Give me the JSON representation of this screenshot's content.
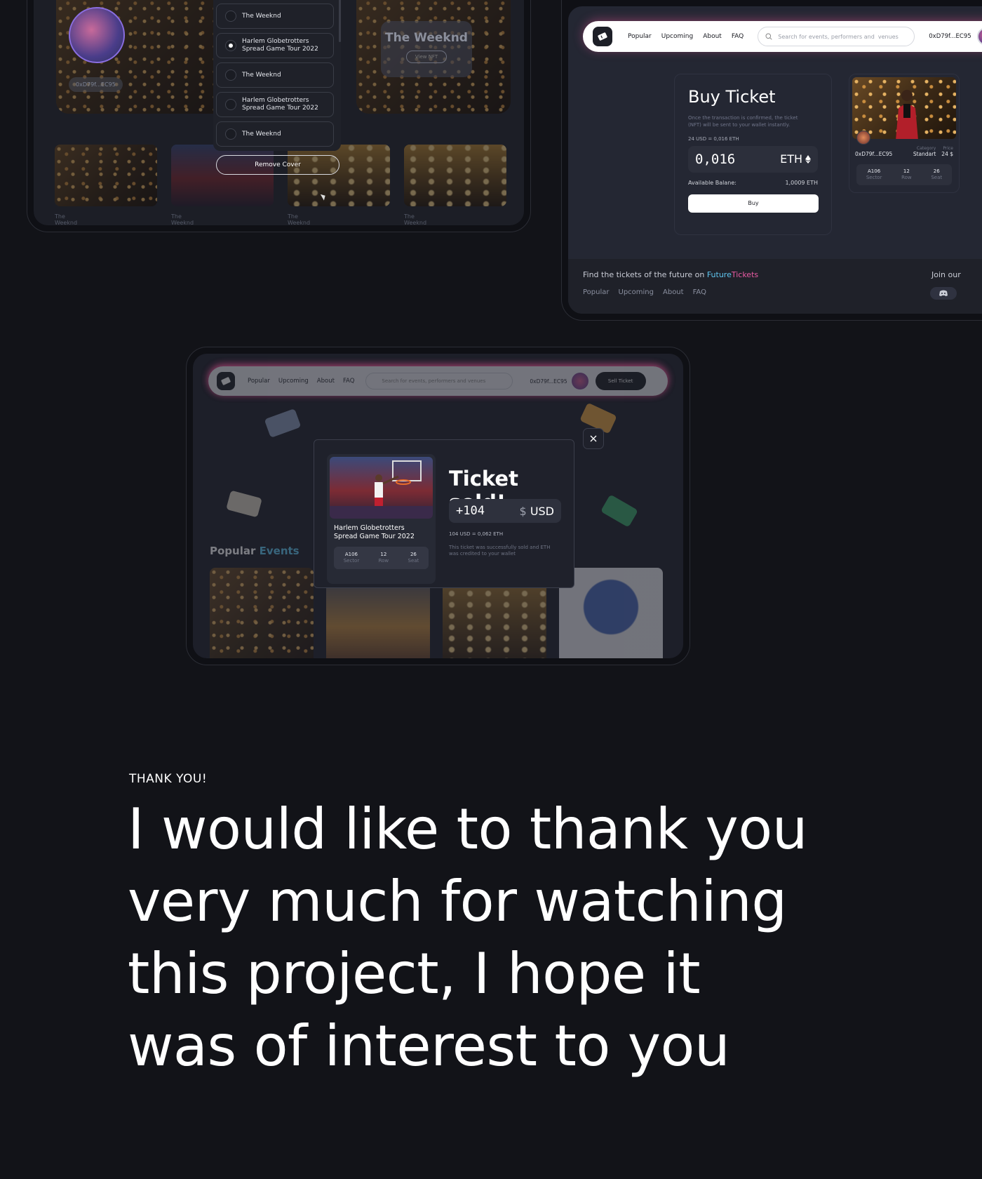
{
  "top_left": {
    "hero_addr": "0xD79f...EC95",
    "hero_card_title": "The Weeknd",
    "hero_card_button": "View NFT",
    "dropdown": {
      "options": [
        {
          "label": "The Weeknd",
          "selected": false
        },
        {
          "label": "Harlem Globetrotters Spread Game Tour 2022",
          "selected": true
        },
        {
          "label": "The Weeknd",
          "selected": false
        },
        {
          "label": "Harlem Globetrotters Spread Game Tour 2022",
          "selected": false
        },
        {
          "label": "The Weeknd",
          "selected": false
        }
      ],
      "remove_label": "Remove Cover"
    },
    "thumb_captions": [
      "The Weeknd",
      "The Weeknd",
      "The Weeknd",
      "The Weeknd"
    ]
  },
  "buy_screen": {
    "nav": {
      "links": [
        "Popular",
        "Upcoming",
        "About",
        "FAQ"
      ],
      "search_placeholder": "Search for events, performers and  venues",
      "wallet": "0xD79f...EC95"
    },
    "panel": {
      "title": "Buy Ticket",
      "description": "Once the transaction is confirmed, the ticket (NFT) will be sent to your wallet instantly.",
      "rate": "24 USD = 0,016 ETH",
      "amount": "0,016",
      "currency": "ETH",
      "balance_label": "Available Balane:",
      "balance_value": "1,0009 ETH",
      "buy_label": "Buy"
    },
    "nft": {
      "owner": "0xD79f...EC95",
      "category_label": "Category",
      "category": "Standart",
      "price_label": "Price",
      "price": "24 $",
      "seat": [
        {
          "value": "A106",
          "label": "Sector"
        },
        {
          "value": "12",
          "label": "Row"
        },
        {
          "value": "26",
          "label": "Seat"
        }
      ]
    },
    "footer": {
      "tagline": "Find the tickets of the future on ",
      "brand_a": "Future",
      "brand_b": "Tickets",
      "links": [
        "Popular",
        "Upcoming",
        "About",
        "FAQ"
      ],
      "join": "Join our"
    }
  },
  "sold_screen": {
    "nav": {
      "links": [
        "Popular",
        "Upcoming",
        "About",
        "FAQ"
      ],
      "search_placeholder": "Search for events, performers and  venues",
      "wallet": "0xD79f...EC95",
      "sell_label": "Sell Ticket"
    },
    "popular": {
      "word1": "Popular",
      "word2": "Events"
    },
    "modal": {
      "event_name": "Harlem Globetrotters Spread Game Tour 2022",
      "seat": [
        {
          "value": "A106",
          "label": "Sector"
        },
        {
          "value": "12",
          "label": "Row"
        },
        {
          "value": "26",
          "label": "Seat"
        }
      ],
      "title": "Ticket sold!",
      "amount": "+104",
      "currency_symbol": "$",
      "currency": "USD",
      "rate": "104 USD = 0,062 ETH",
      "note": "This ticket was successfully sold and ETH was credited to your wallet"
    }
  },
  "thanks": {
    "label": "THANK YOU!",
    "lines": [
      "I would like to thank you",
      "very much for watching",
      "this project, I hope it",
      "was of interest to you"
    ]
  }
}
